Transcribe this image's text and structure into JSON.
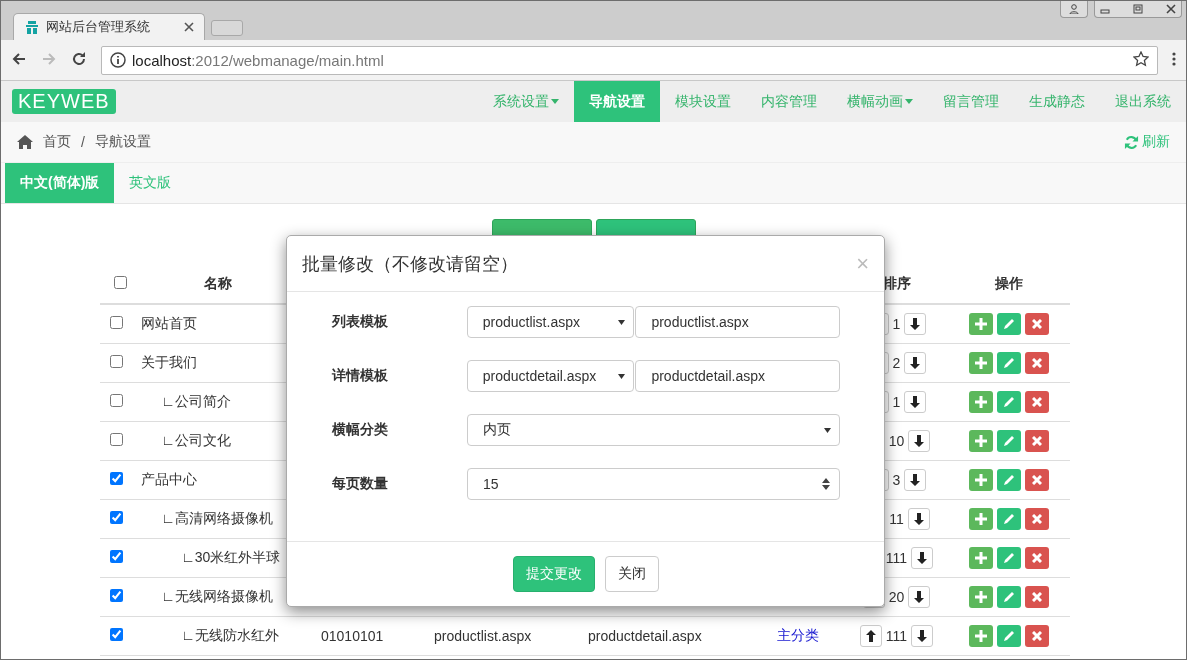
{
  "browser": {
    "tab_title": "网站后台管理系统",
    "url_host": "localhost",
    "url_path": ":2012/webmanage/main.html"
  },
  "logo": "KEYWEB",
  "nav": [
    {
      "label": "系统设置",
      "selected": false,
      "dropdown": true
    },
    {
      "label": "导航设置",
      "selected": true,
      "dropdown": false
    },
    {
      "label": "模块设置",
      "selected": false,
      "dropdown": false
    },
    {
      "label": "内容管理",
      "selected": false,
      "dropdown": false
    },
    {
      "label": "横幅动画",
      "selected": false,
      "dropdown": true
    },
    {
      "label": "留言管理",
      "selected": false,
      "dropdown": false
    },
    {
      "label": "生成静态",
      "selected": false,
      "dropdown": false
    },
    {
      "label": "退出系统",
      "selected": false,
      "dropdown": false
    }
  ],
  "breadcrumb": [
    "首页",
    "导航设置"
  ],
  "breadcrumb_separator": "/",
  "refresh": "刷新",
  "lang_tabs": [
    {
      "label": "中文(简体)版",
      "selected": true
    },
    {
      "label": "英文版",
      "selected": false
    }
  ],
  "table": {
    "columns": {
      "name": "名称",
      "sort": "排序",
      "ops": "操作"
    },
    "header_checked": false,
    "rows": [
      {
        "name": "网站首页",
        "checked": false,
        "sort": "1"
      },
      {
        "name": "关于我们",
        "checked": false,
        "sort": "2",
        "children": [
          {
            "name": "∟公司简介",
            "checked": false,
            "sort": "1"
          },
          {
            "name": "∟公司文化",
            "checked": false,
            "sort": "10"
          }
        ]
      },
      {
        "name": "产品中心",
        "checked": true,
        "sort": "3",
        "children": [
          {
            "name": "∟高清网络摄像机",
            "checked": true,
            "sort": "11",
            "children": [
              {
                "name": "∟30米红外半球",
                "checked": true,
                "sort": "111"
              }
            ]
          },
          {
            "name": "∟无线网络摄像机",
            "checked": true,
            "sort": "20",
            "children": [
              {
                "name": "∟无线防水红外",
                "checked": true,
                "code": "01010101",
                "list_template": "productlist.aspx",
                "detail_template": "productdetail.aspx",
                "type": "主分类",
                "sort": "111"
              }
            ]
          }
        ]
      }
    ]
  },
  "modal": {
    "title": "批量修改（不修改请留空）",
    "close": "×",
    "fields": [
      {
        "kind": "select-pair",
        "label": "列表模板",
        "select": "productlist.aspx",
        "value": "productlist.aspx"
      },
      {
        "kind": "select-pair",
        "label": "详情模板",
        "select": "productdetail.aspx",
        "value": "productdetail.aspx"
      },
      {
        "kind": "select",
        "label": "横幅分类",
        "select": "内页"
      },
      {
        "kind": "number",
        "label": "每页数量",
        "value": "15"
      }
    ],
    "buttons": [
      {
        "label": "提交更改",
        "kind": "primary"
      },
      {
        "label": "关闭",
        "kind": "default"
      }
    ]
  }
}
